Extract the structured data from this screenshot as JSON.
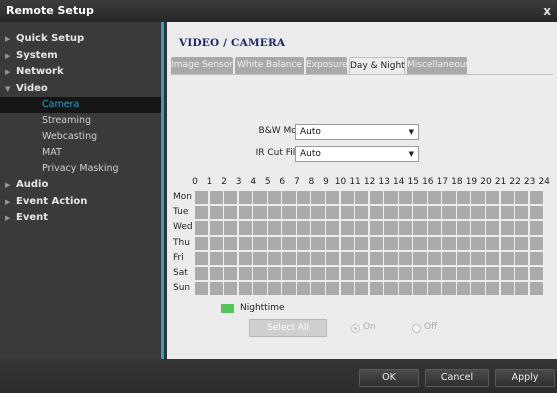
{
  "window": {
    "title": "Remote Setup",
    "close_label": "x"
  },
  "sidebar": {
    "items": [
      {
        "label": "Quick Setup",
        "expanded": false
      },
      {
        "label": "System",
        "expanded": false
      },
      {
        "label": "Network",
        "expanded": false
      },
      {
        "label": "Video",
        "expanded": true,
        "children": [
          "Camera",
          "Streaming",
          "Webcasting",
          "MAT",
          "Privacy Masking"
        ]
      },
      {
        "label": "Audio",
        "expanded": false
      },
      {
        "label": "Event Action",
        "expanded": false
      },
      {
        "label": "Event",
        "expanded": false
      }
    ],
    "active_child": "Camera",
    "arrow_collapsed": "▶",
    "arrow_expanded": "▼"
  },
  "main": {
    "page_title": "VIDEO / CAMERA",
    "tabs": [
      "Image Sensor",
      "White Balance",
      "Exposure",
      "Day & Night",
      "Miscellaneous"
    ],
    "active_tab": "Day & Night",
    "bw_mode": {
      "label": "B&W Mode",
      "value": "Auto"
    },
    "ir_cut_filter": {
      "label": "IR Cut Filter",
      "value": "Auto"
    },
    "caret": "▼",
    "schedule": {
      "hours": [
        "0",
        "1",
        "2",
        "3",
        "4",
        "5",
        "6",
        "7",
        "8",
        "9",
        "10",
        "11",
        "12",
        "13",
        "14",
        "15",
        "16",
        "17",
        "18",
        "19",
        "20",
        "21",
        "22",
        "23",
        "24"
      ],
      "days": [
        "Mon",
        "Tue",
        "Wed",
        "Thu",
        "Fri",
        "Sat",
        "Sun"
      ],
      "cell_color": "#aaaaaa"
    },
    "legend": {
      "label": "Nighttime",
      "color": "#55c45a"
    },
    "select_all_label": "Select All",
    "radio_on_label": "On",
    "radio_off_label": "Off",
    "radio_selected": "On"
  },
  "footer": {
    "ok_label": "OK",
    "cancel_label": "Cancel",
    "apply_label": "Apply"
  },
  "colors": {
    "accent": "#29a3c7",
    "title": "#1a2a6e"
  }
}
